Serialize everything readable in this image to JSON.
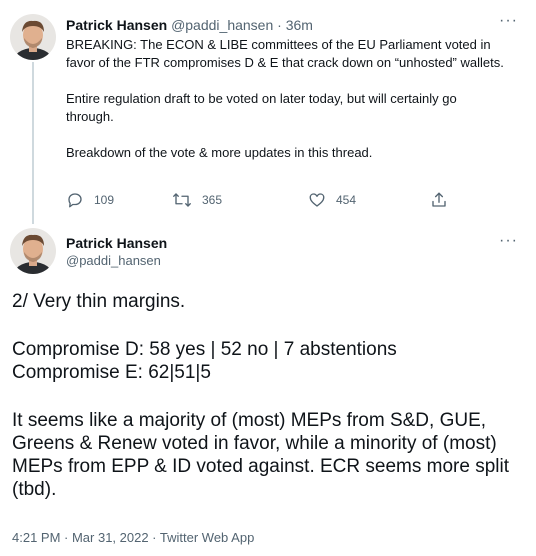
{
  "tweet1": {
    "name": "Patrick Hansen",
    "handle_time": "@paddi_hansen · 36m",
    "paragraphs": [
      "BREAKING: The ECON & LIBE committees of the EU Parliament voted in favor of the FTR compromises D & E that crack down on “unhosted” wallets.",
      "Entire regulation draft to be voted on later today, but will certainly go through.",
      "Breakdown of the vote & more updates in this thread."
    ],
    "stats": {
      "replies": "109",
      "retweets": "365",
      "likes": "454"
    },
    "more": "···"
  },
  "tweet2": {
    "name": "Patrick Hansen",
    "handle": "@paddi_hansen",
    "more": "···",
    "lines": {
      "intro": "2/ Very thin margins.",
      "compromise_d": "Compromise D: 58 yes | 52 no | 7 abstentions",
      "compromise_e": "Compromise E: 62|51|5",
      "analysis": "It seems like a majority of (most) MEPs from S&D, GUE, Greens & Renew voted in favor, while a minority of (most) MEPs from EPP & ID voted against. ECR seems more split (tbd)."
    },
    "meta": "4:21 PM · Mar 31, 2022 · Twitter Web App"
  },
  "colors": {
    "text": "#0f1419",
    "secondary": "#536471",
    "thread_line": "#cfd9de"
  },
  "icons": [
    "reply-icon",
    "retweet-icon",
    "like-icon",
    "share-icon",
    "more-icon"
  ]
}
